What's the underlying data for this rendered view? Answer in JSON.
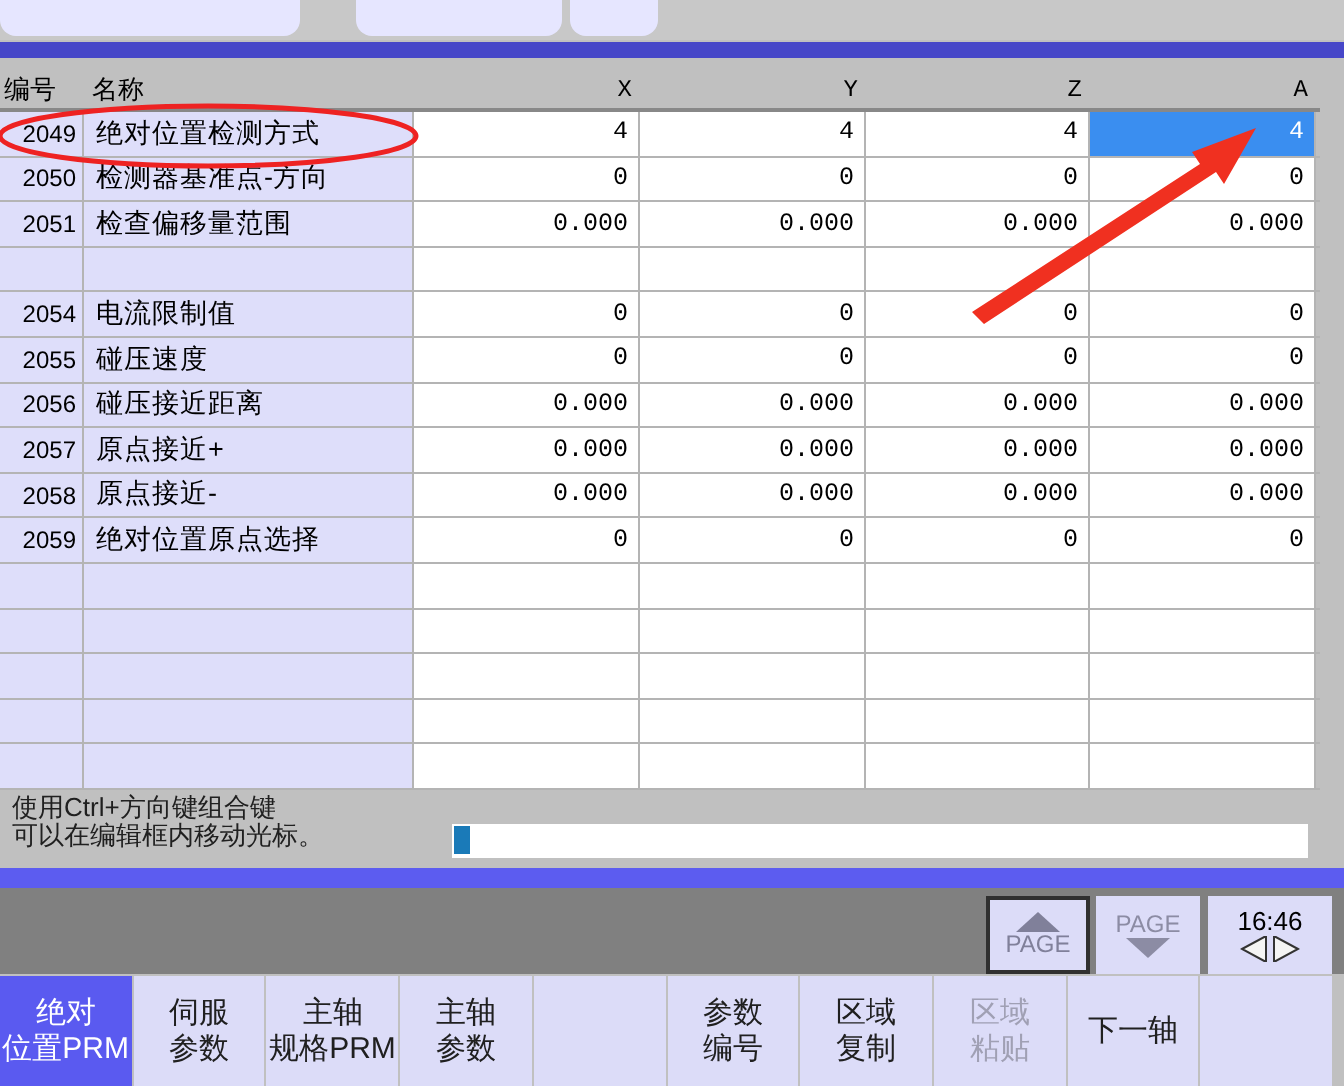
{
  "table": {
    "columns": [
      "编号",
      "名称",
      "X",
      "Y",
      "Z",
      "A"
    ],
    "rows": [
      {
        "kind": "param",
        "number": "2049",
        "name": "绝对位置检测方式",
        "values": [
          {
            "text": "4",
            "selected": false
          },
          {
            "text": "4",
            "selected": false
          },
          {
            "text": "4",
            "selected": false
          },
          {
            "text": "4",
            "selected": true
          }
        ]
      },
      {
        "kind": "param",
        "number": "2050",
        "name": "检测器基准点-方向",
        "values": [
          {
            "text": "0",
            "selected": false
          },
          {
            "text": "0",
            "selected": false
          },
          {
            "text": "0",
            "selected": false
          },
          {
            "text": "0",
            "selected": false
          }
        ]
      },
      {
        "kind": "param",
        "number": "2051",
        "name": "检查偏移量范围",
        "values": [
          {
            "text": "0.000",
            "selected": false
          },
          {
            "text": "0.000",
            "selected": false
          },
          {
            "text": "0.000",
            "selected": false
          },
          {
            "text": "0.000",
            "selected": false
          }
        ]
      },
      {
        "kind": "empty"
      },
      {
        "kind": "param",
        "number": "2054",
        "name": "电流限制值",
        "values": [
          {
            "text": "0",
            "selected": false
          },
          {
            "text": "0",
            "selected": false
          },
          {
            "text": "0",
            "selected": false
          },
          {
            "text": "0",
            "selected": false
          }
        ]
      },
      {
        "kind": "param",
        "number": "2055",
        "name": "碰压速度",
        "values": [
          {
            "text": "0",
            "selected": false
          },
          {
            "text": "0",
            "selected": false
          },
          {
            "text": "0",
            "selected": false
          },
          {
            "text": "0",
            "selected": false
          }
        ]
      },
      {
        "kind": "param",
        "number": "2056",
        "name": "碰压接近距离",
        "values": [
          {
            "text": "0.000",
            "selected": false
          },
          {
            "text": "0.000",
            "selected": false
          },
          {
            "text": "0.000",
            "selected": false
          },
          {
            "text": "0.000",
            "selected": false
          }
        ]
      },
      {
        "kind": "param",
        "number": "2057",
        "name": "原点接近+",
        "values": [
          {
            "text": "0.000",
            "selected": false
          },
          {
            "text": "0.000",
            "selected": false
          },
          {
            "text": "0.000",
            "selected": false
          },
          {
            "text": "0.000",
            "selected": false
          }
        ]
      },
      {
        "kind": "param",
        "number": "2058",
        "name": "原点接近-",
        "values": [
          {
            "text": "0.000",
            "selected": false
          },
          {
            "text": "0.000",
            "selected": false
          },
          {
            "text": "0.000",
            "selected": false
          },
          {
            "text": "0.000",
            "selected": false
          }
        ]
      },
      {
        "kind": "param",
        "number": "2059",
        "name": "绝对位置原点选择",
        "values": [
          {
            "text": "0",
            "selected": false
          },
          {
            "text": "0",
            "selected": false
          },
          {
            "text": "0",
            "selected": false
          },
          {
            "text": "0",
            "selected": false
          }
        ]
      },
      {
        "kind": "empty"
      },
      {
        "kind": "empty"
      },
      {
        "kind": "empty"
      },
      {
        "kind": "empty"
      },
      {
        "kind": "empty"
      }
    ]
  },
  "message": [
    "使用Ctrl+方向键组合键",
    "可以在编辑框内移动光标。"
  ],
  "page_buttons": [
    {
      "label": "PAGE",
      "kind": "up",
      "disabled": false
    },
    {
      "label": "PAGE",
      "kind": "down",
      "disabled": true
    }
  ],
  "clock": "16:46",
  "softkeys": [
    {
      "lines": [
        "绝对",
        "位置PRM"
      ],
      "selected": true,
      "disabled": false
    },
    {
      "lines": [
        "伺服",
        "参数"
      ],
      "selected": false,
      "disabled": false
    },
    {
      "lines": [
        "主轴",
        "规格PRM"
      ],
      "selected": false,
      "disabled": false
    },
    {
      "lines": [
        "主轴",
        "参数"
      ],
      "selected": false,
      "disabled": false
    },
    {
      "kind": "blank"
    },
    {
      "lines": [
        "参数",
        "编号"
      ],
      "selected": false,
      "disabled": false
    },
    {
      "lines": [
        "区域",
        "复制"
      ],
      "selected": false,
      "disabled": false
    },
    {
      "lines": [
        "区域",
        "粘贴"
      ],
      "selected": false,
      "disabled": true
    },
    {
      "lines": [
        "下一轴"
      ],
      "selected": false,
      "disabled": false
    },
    {
      "kind": "blank"
    }
  ]
}
